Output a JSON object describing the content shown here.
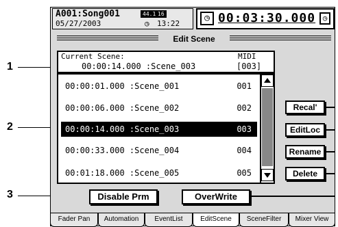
{
  "header": {
    "song": "A001:Song001",
    "date": "05/27/2003",
    "rate_badge": "44.1k",
    "bit_badge": "16",
    "clock_icon": "clock-icon",
    "time_of_day": "13:22",
    "counter": "00:03:30.000",
    "counter_icon": "clock-icon"
  },
  "title": "Edit Scene",
  "current": {
    "label": "Current Scene:",
    "midi_label": "MIDI",
    "value": "00:00:14.000 :Scene_003",
    "midi": "[003]"
  },
  "scenes": [
    {
      "time": "00:00:01.000 :Scene_001",
      "num": "001"
    },
    {
      "time": "00:00:06.000 :Scene_002",
      "num": "002"
    },
    {
      "time": "00:00:14.000 :Scene_003",
      "num": "003"
    },
    {
      "time": "00:00:33.000 :Scene_004",
      "num": "004"
    },
    {
      "time": "00:01:18.000 :Scene_005",
      "num": "005"
    }
  ],
  "buttons": {
    "recall": "Recal'",
    "editloc": "EditLoc",
    "rename": "Rename",
    "delete": "Delete",
    "disable": "Disable Prm",
    "overwrite": "OverWrite"
  },
  "tabs": [
    "Fader Pan",
    "Automation",
    "EventList",
    "EditScene",
    "SceneFilter",
    "Mixer View"
  ],
  "callouts": [
    "1",
    "2",
    "3"
  ]
}
